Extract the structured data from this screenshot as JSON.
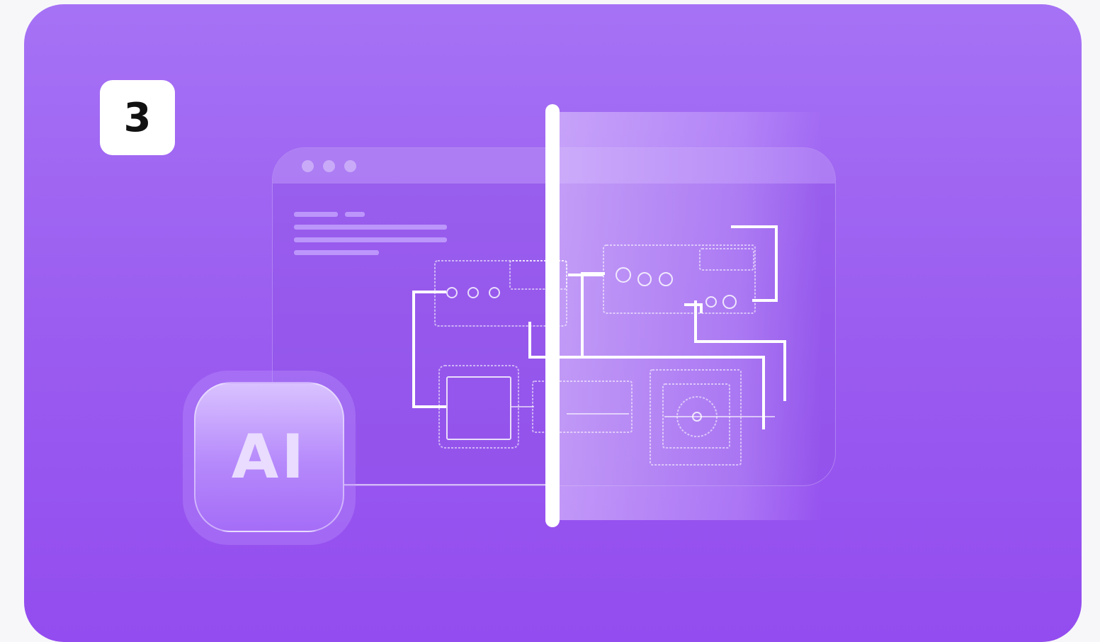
{
  "step": {
    "number": "3"
  },
  "ai_badge": {
    "label": "AI"
  },
  "colors": {
    "background_top": "#a672f5",
    "background_bottom": "#934cef",
    "page": "#f7f7fa",
    "badge": "#ffffff",
    "wire": "#ffffff"
  },
  "icons": [
    "window-icon",
    "ai-app-icon",
    "circuit-diagram-icon"
  ]
}
